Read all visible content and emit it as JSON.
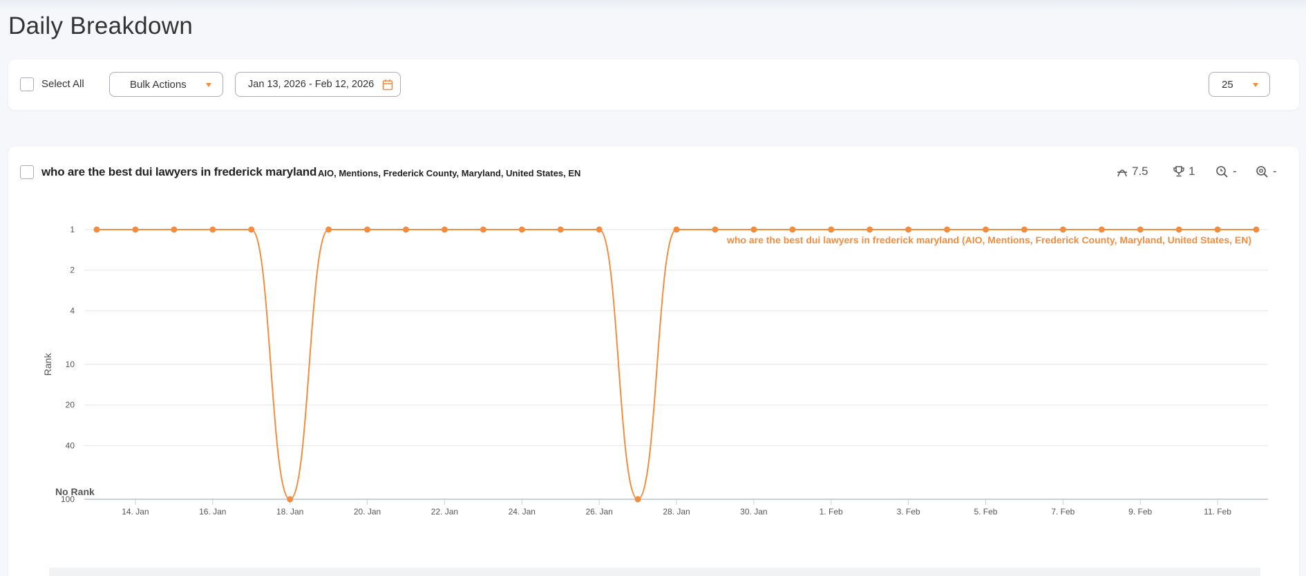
{
  "page": {
    "title": "Daily Breakdown"
  },
  "toolbar": {
    "select_all_label": "Select All",
    "bulk_actions_label": "Bulk Actions",
    "date_range": "Jan 13, 2026 - Feb 12, 2026",
    "per_page": "25"
  },
  "keyword": {
    "title": "who are the best dui lawyers in frederick maryland",
    "meta": "AIO, Mentions, Frederick County, Maryland, United States, EN",
    "metrics": {
      "avg_rank": "7.5",
      "best_rank": "1",
      "search_volume": "-",
      "visibility": "-"
    }
  },
  "colors": {
    "accent": "#f28c3f",
    "grid": "#e6e6e6"
  },
  "icons": [
    "checkbox-icon",
    "caret-down-icon",
    "calendar-icon",
    "avg-rank-icon",
    "trophy-icon",
    "search-clock-icon",
    "search-target-icon"
  ],
  "chart_data": {
    "type": "line",
    "ylabel": "Rank",
    "y_ticks": [
      "1",
      "2",
      "4",
      "10",
      "20",
      "40",
      "100"
    ],
    "y_scale": "log",
    "y_inverted": true,
    "no_rank_label": "No Rank",
    "x_ticks": [
      "14. Jan",
      "16. Jan",
      "18. Jan",
      "20. Jan",
      "22. Jan",
      "24. Jan",
      "26. Jan",
      "28. Jan",
      "30. Jan",
      "1. Feb",
      "3. Feb",
      "5. Feb",
      "7. Feb",
      "9. Feb",
      "11. Feb"
    ],
    "series": [
      {
        "name": "who are the best dui lawyers in frederick maryland (AIO, Mentions, Frederick County, Maryland, United States, EN)",
        "x": [
          "13. Jan",
          "14. Jan",
          "15. Jan",
          "16. Jan",
          "17. Jan",
          "18. Jan",
          "19. Jan",
          "20. Jan",
          "21. Jan",
          "22. Jan",
          "23. Jan",
          "24. Jan",
          "25. Jan",
          "26. Jan",
          "27. Jan",
          "28. Jan",
          "29. Jan",
          "30. Jan",
          "31. Jan",
          "1. Feb",
          "2. Feb",
          "3. Feb",
          "4. Feb",
          "5. Feb",
          "6. Feb",
          "7. Feb",
          "8. Feb",
          "9. Feb",
          "10. Feb",
          "11. Feb",
          "12. Feb"
        ],
        "values": [
          1,
          1,
          1,
          1,
          1,
          "No Rank",
          1,
          1,
          1,
          1,
          1,
          1,
          1,
          1,
          "No Rank",
          1,
          1,
          1,
          1,
          1,
          1,
          1,
          1,
          1,
          1,
          1,
          1,
          1,
          1,
          1,
          1
        ]
      }
    ]
  }
}
